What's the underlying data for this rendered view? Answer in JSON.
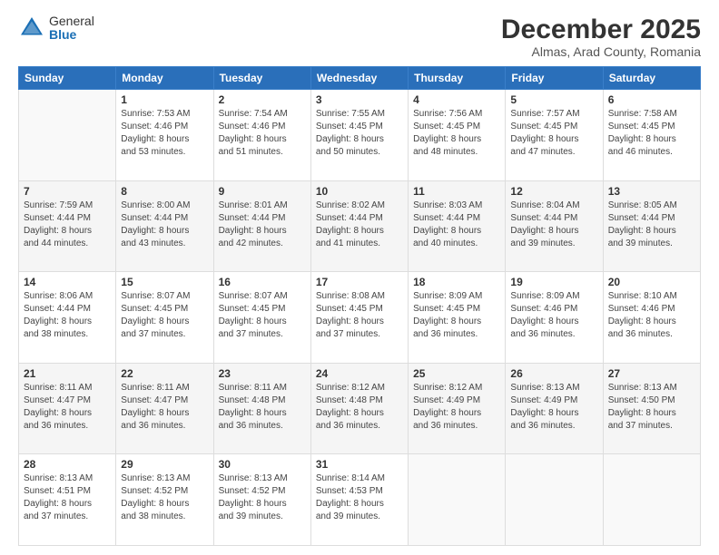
{
  "logo": {
    "general": "General",
    "blue": "Blue"
  },
  "header": {
    "title": "December 2025",
    "subtitle": "Almas, Arad County, Romania"
  },
  "weekdays": [
    "Sunday",
    "Monday",
    "Tuesday",
    "Wednesday",
    "Thursday",
    "Friday",
    "Saturday"
  ],
  "weeks": [
    [
      {
        "day": "",
        "info": ""
      },
      {
        "day": "1",
        "info": "Sunrise: 7:53 AM\nSunset: 4:46 PM\nDaylight: 8 hours\nand 53 minutes."
      },
      {
        "day": "2",
        "info": "Sunrise: 7:54 AM\nSunset: 4:46 PM\nDaylight: 8 hours\nand 51 minutes."
      },
      {
        "day": "3",
        "info": "Sunrise: 7:55 AM\nSunset: 4:45 PM\nDaylight: 8 hours\nand 50 minutes."
      },
      {
        "day": "4",
        "info": "Sunrise: 7:56 AM\nSunset: 4:45 PM\nDaylight: 8 hours\nand 48 minutes."
      },
      {
        "day": "5",
        "info": "Sunrise: 7:57 AM\nSunset: 4:45 PM\nDaylight: 8 hours\nand 47 minutes."
      },
      {
        "day": "6",
        "info": "Sunrise: 7:58 AM\nSunset: 4:45 PM\nDaylight: 8 hours\nand 46 minutes."
      }
    ],
    [
      {
        "day": "7",
        "info": "Sunrise: 7:59 AM\nSunset: 4:44 PM\nDaylight: 8 hours\nand 44 minutes."
      },
      {
        "day": "8",
        "info": "Sunrise: 8:00 AM\nSunset: 4:44 PM\nDaylight: 8 hours\nand 43 minutes."
      },
      {
        "day": "9",
        "info": "Sunrise: 8:01 AM\nSunset: 4:44 PM\nDaylight: 8 hours\nand 42 minutes."
      },
      {
        "day": "10",
        "info": "Sunrise: 8:02 AM\nSunset: 4:44 PM\nDaylight: 8 hours\nand 41 minutes."
      },
      {
        "day": "11",
        "info": "Sunrise: 8:03 AM\nSunset: 4:44 PM\nDaylight: 8 hours\nand 40 minutes."
      },
      {
        "day": "12",
        "info": "Sunrise: 8:04 AM\nSunset: 4:44 PM\nDaylight: 8 hours\nand 39 minutes."
      },
      {
        "day": "13",
        "info": "Sunrise: 8:05 AM\nSunset: 4:44 PM\nDaylight: 8 hours\nand 39 minutes."
      }
    ],
    [
      {
        "day": "14",
        "info": "Sunrise: 8:06 AM\nSunset: 4:44 PM\nDaylight: 8 hours\nand 38 minutes."
      },
      {
        "day": "15",
        "info": "Sunrise: 8:07 AM\nSunset: 4:45 PM\nDaylight: 8 hours\nand 37 minutes."
      },
      {
        "day": "16",
        "info": "Sunrise: 8:07 AM\nSunset: 4:45 PM\nDaylight: 8 hours\nand 37 minutes."
      },
      {
        "day": "17",
        "info": "Sunrise: 8:08 AM\nSunset: 4:45 PM\nDaylight: 8 hours\nand 37 minutes."
      },
      {
        "day": "18",
        "info": "Sunrise: 8:09 AM\nSunset: 4:45 PM\nDaylight: 8 hours\nand 36 minutes."
      },
      {
        "day": "19",
        "info": "Sunrise: 8:09 AM\nSunset: 4:46 PM\nDaylight: 8 hours\nand 36 minutes."
      },
      {
        "day": "20",
        "info": "Sunrise: 8:10 AM\nSunset: 4:46 PM\nDaylight: 8 hours\nand 36 minutes."
      }
    ],
    [
      {
        "day": "21",
        "info": "Sunrise: 8:11 AM\nSunset: 4:47 PM\nDaylight: 8 hours\nand 36 minutes."
      },
      {
        "day": "22",
        "info": "Sunrise: 8:11 AM\nSunset: 4:47 PM\nDaylight: 8 hours\nand 36 minutes."
      },
      {
        "day": "23",
        "info": "Sunrise: 8:11 AM\nSunset: 4:48 PM\nDaylight: 8 hours\nand 36 minutes."
      },
      {
        "day": "24",
        "info": "Sunrise: 8:12 AM\nSunset: 4:48 PM\nDaylight: 8 hours\nand 36 minutes."
      },
      {
        "day": "25",
        "info": "Sunrise: 8:12 AM\nSunset: 4:49 PM\nDaylight: 8 hours\nand 36 minutes."
      },
      {
        "day": "26",
        "info": "Sunrise: 8:13 AM\nSunset: 4:49 PM\nDaylight: 8 hours\nand 36 minutes."
      },
      {
        "day": "27",
        "info": "Sunrise: 8:13 AM\nSunset: 4:50 PM\nDaylight: 8 hours\nand 37 minutes."
      }
    ],
    [
      {
        "day": "28",
        "info": "Sunrise: 8:13 AM\nSunset: 4:51 PM\nDaylight: 8 hours\nand 37 minutes."
      },
      {
        "day": "29",
        "info": "Sunrise: 8:13 AM\nSunset: 4:52 PM\nDaylight: 8 hours\nand 38 minutes."
      },
      {
        "day": "30",
        "info": "Sunrise: 8:13 AM\nSunset: 4:52 PM\nDaylight: 8 hours\nand 39 minutes."
      },
      {
        "day": "31",
        "info": "Sunrise: 8:14 AM\nSunset: 4:53 PM\nDaylight: 8 hours\nand 39 minutes."
      },
      {
        "day": "",
        "info": ""
      },
      {
        "day": "",
        "info": ""
      },
      {
        "day": "",
        "info": ""
      }
    ]
  ]
}
